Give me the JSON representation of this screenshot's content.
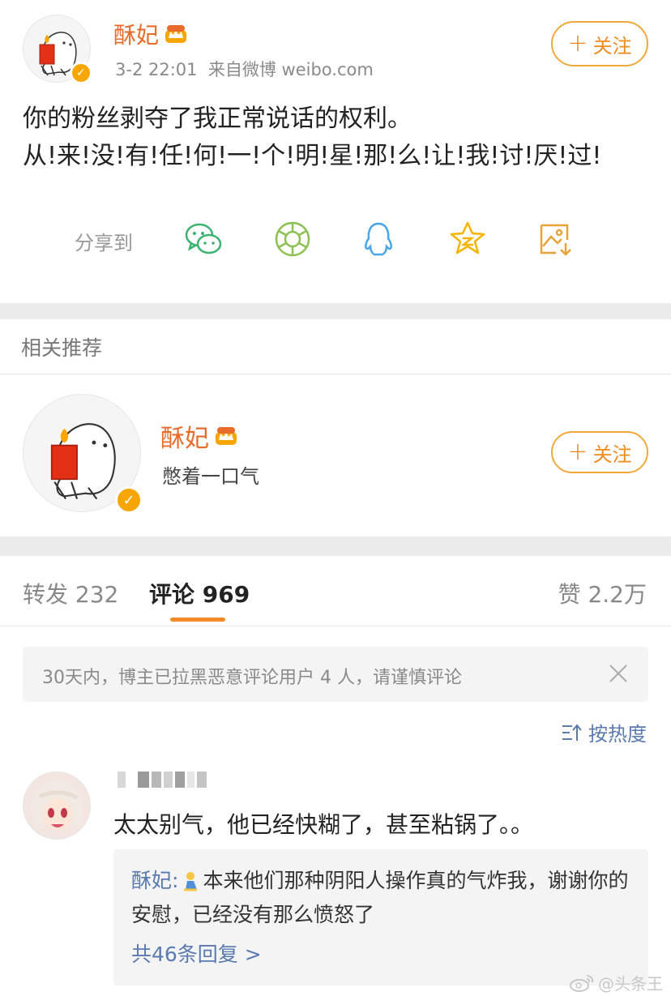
{
  "post": {
    "author": "酥妃",
    "time": "3-2 22:01",
    "source": "来自微博 weibo.com",
    "follow_label": "关注",
    "text_line1": "你的粉丝剥夺了我正常说话的权利。",
    "text_line2": "从!来!没!有!任!何!一!个!明!星!那!么!让!我!讨!厌!过!",
    "share_label": "分享到",
    "share_targets": [
      "wechat-icon",
      "moments-icon",
      "qq-icon",
      "qzone-icon",
      "save-image-icon"
    ]
  },
  "recommend": {
    "section_title": "相关推荐",
    "name": "酥妃",
    "bio": "憋着一口气",
    "follow_label": "关注"
  },
  "tabs": {
    "repost": "转发 232",
    "comment": "评论 969",
    "like": "赞 2.2万"
  },
  "notice": {
    "text": "30天内，博主已拉黑恶意评论用户 4 人，请谨慎评论"
  },
  "sort": {
    "label": "按热度"
  },
  "comment": {
    "text": "太太别气，他已经快糊了，甚至粘锅了。。",
    "reply_author": "酥妃:",
    "reply_text": "本来他们那种阴阳人操作真的气炸我，谢谢你的安慰，已经没有那么愤怒了",
    "reply_more": "共46条回复 >"
  },
  "watermark": {
    "text": "@头条王"
  },
  "colors": {
    "brand_orange": "#e86b2a",
    "link_blue": "#5a7ab0",
    "follow_border": "#f2a93b",
    "tab_underline": "#f58a27"
  }
}
